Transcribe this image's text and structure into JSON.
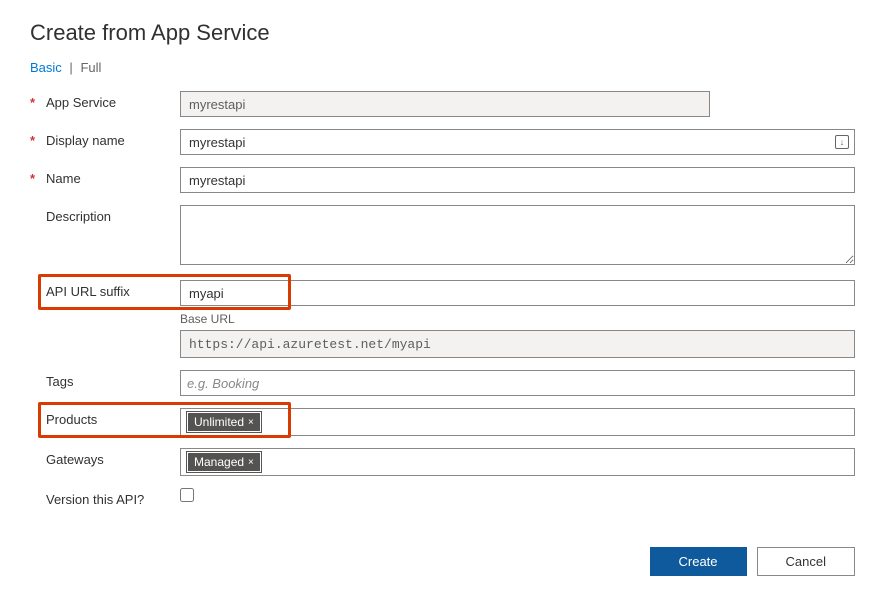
{
  "title": "Create from App Service",
  "tabs": {
    "basic": "Basic",
    "full": "Full"
  },
  "fields": {
    "appService": {
      "label": "App Service",
      "value": "myrestapi"
    },
    "displayName": {
      "label": "Display name",
      "value": "myrestapi"
    },
    "name": {
      "label": "Name",
      "value": "myrestapi"
    },
    "description": {
      "label": "Description",
      "value": ""
    },
    "apiUrlSuffix": {
      "label": "API URL suffix",
      "value": "myapi"
    },
    "baseUrl": {
      "label": "Base URL",
      "value": "https://api.azuretest.net/myapi"
    },
    "tags": {
      "label": "Tags",
      "placeholder": "e.g. Booking"
    },
    "products": {
      "label": "Products",
      "chip": "Unlimited"
    },
    "gateways": {
      "label": "Gateways",
      "chip": "Managed"
    },
    "versionApi": {
      "label": "Version this API?"
    }
  },
  "buttons": {
    "create": "Create",
    "cancel": "Cancel"
  },
  "icons": {
    "autofill": "↓"
  }
}
